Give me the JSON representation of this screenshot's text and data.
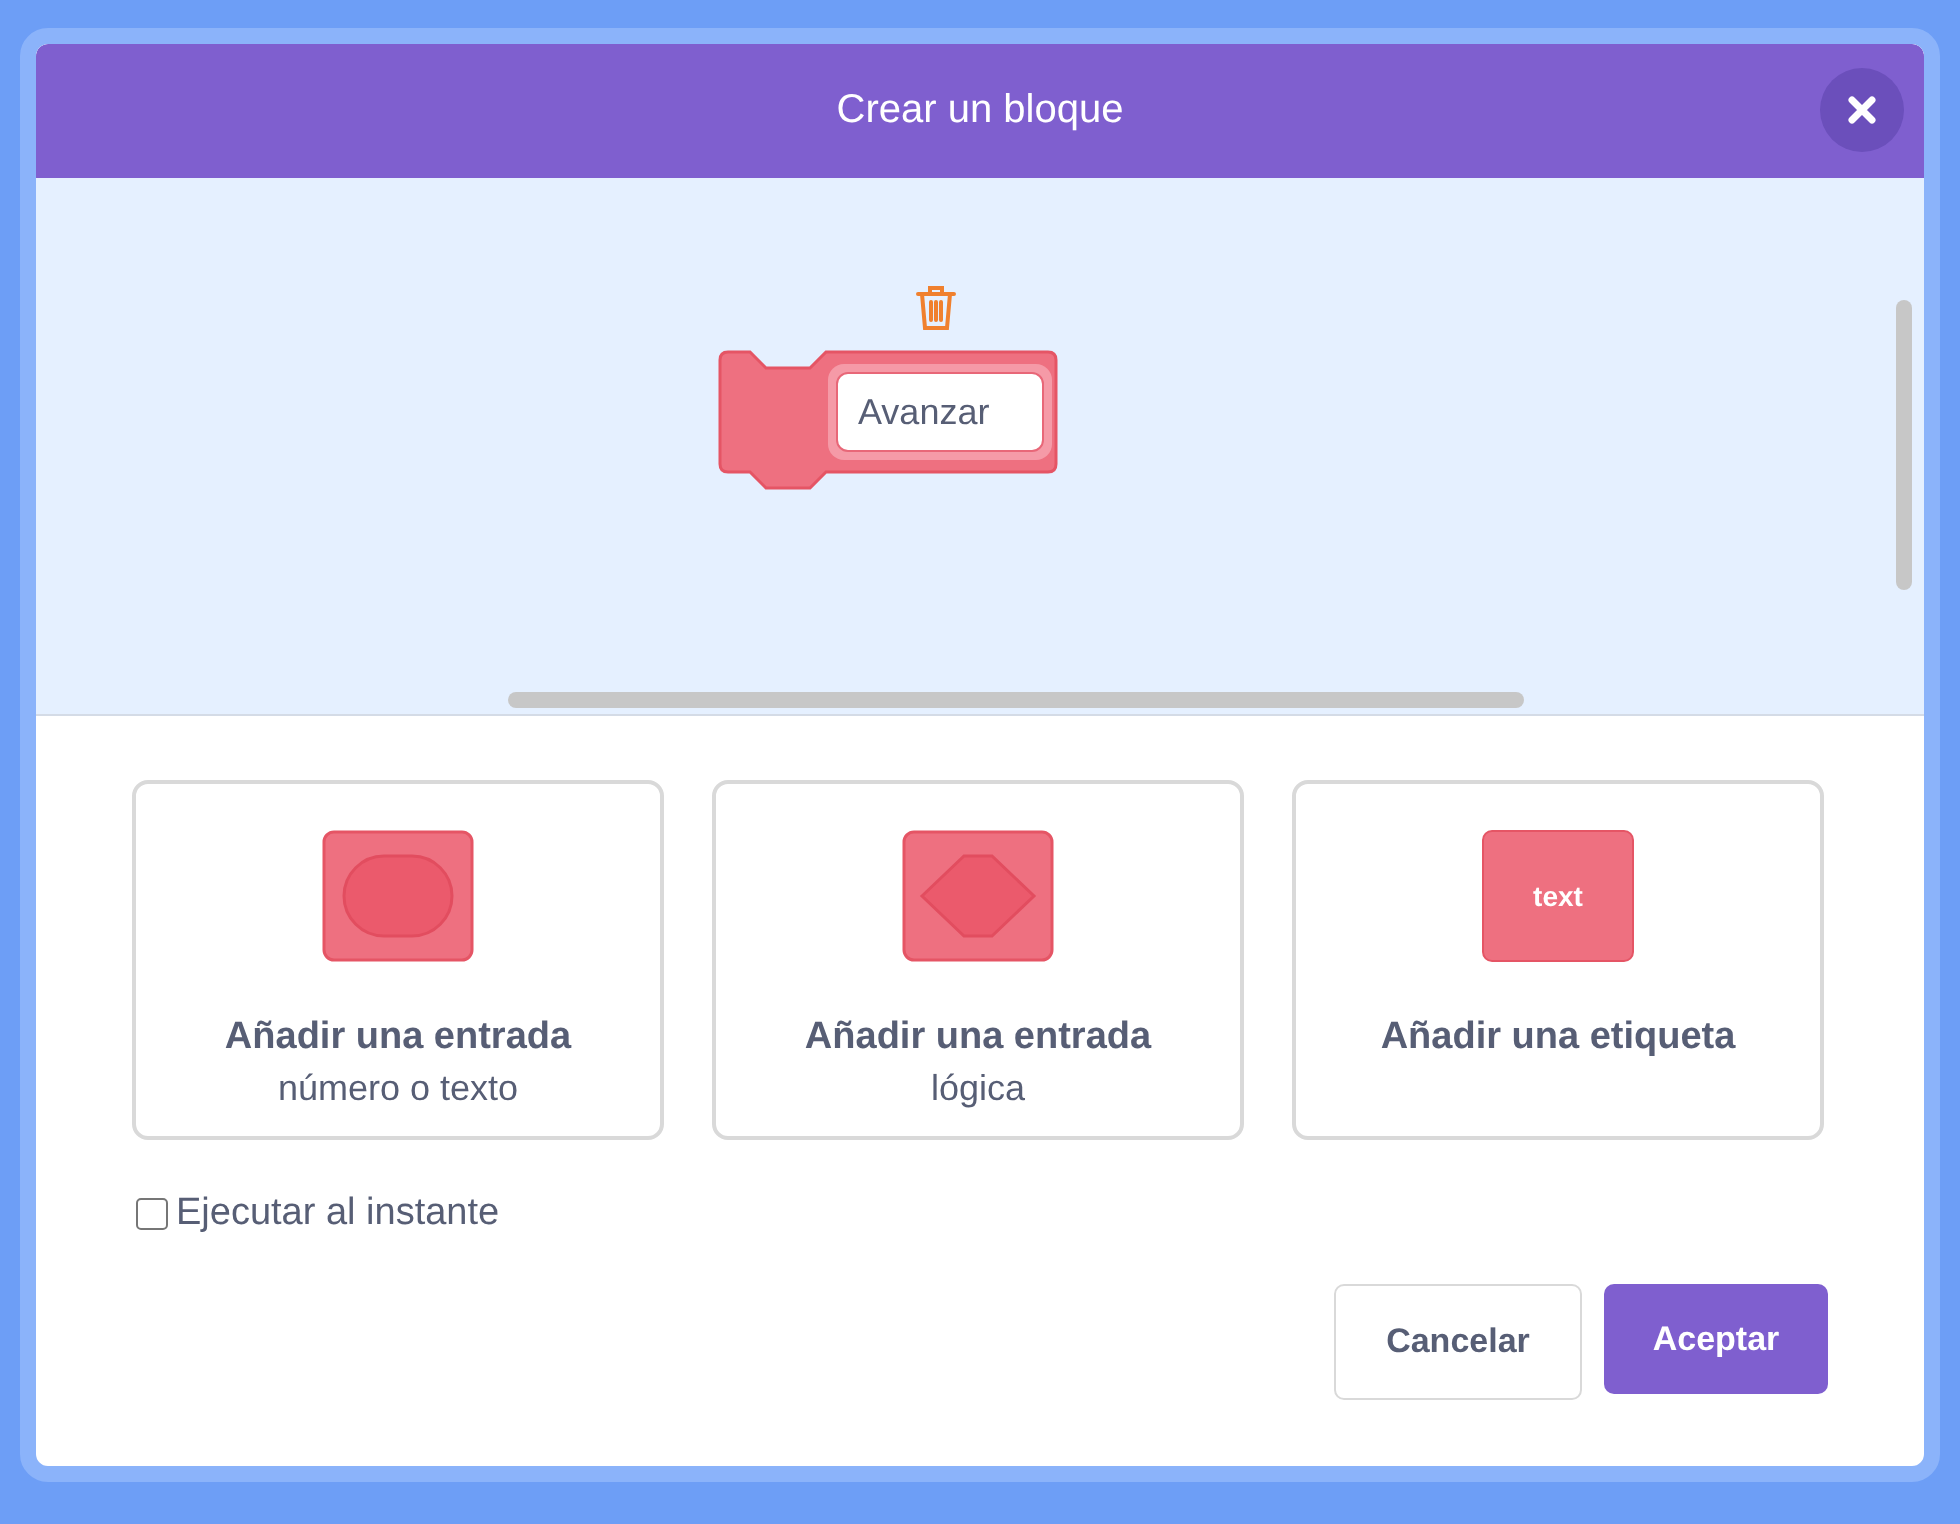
{
  "window": {
    "title": "Crear un bloque"
  },
  "block": {
    "value": "Avanzar"
  },
  "options": [
    {
      "kind": "number_text",
      "title": "Añadir una entrada",
      "subtitle": "número o texto"
    },
    {
      "kind": "boolean",
      "title": "Añadir una entrada",
      "subtitle": "lógica"
    },
    {
      "kind": "label",
      "title": "Añadir una etiqueta",
      "icon_text": "text"
    }
  ],
  "run_instantly": {
    "label": "Ejecutar al instante",
    "checked": false
  },
  "buttons": [
    {
      "label": "Cancelar",
      "kind": "secondary"
    },
    {
      "label": "Aceptar",
      "kind": "primary"
    }
  ]
}
